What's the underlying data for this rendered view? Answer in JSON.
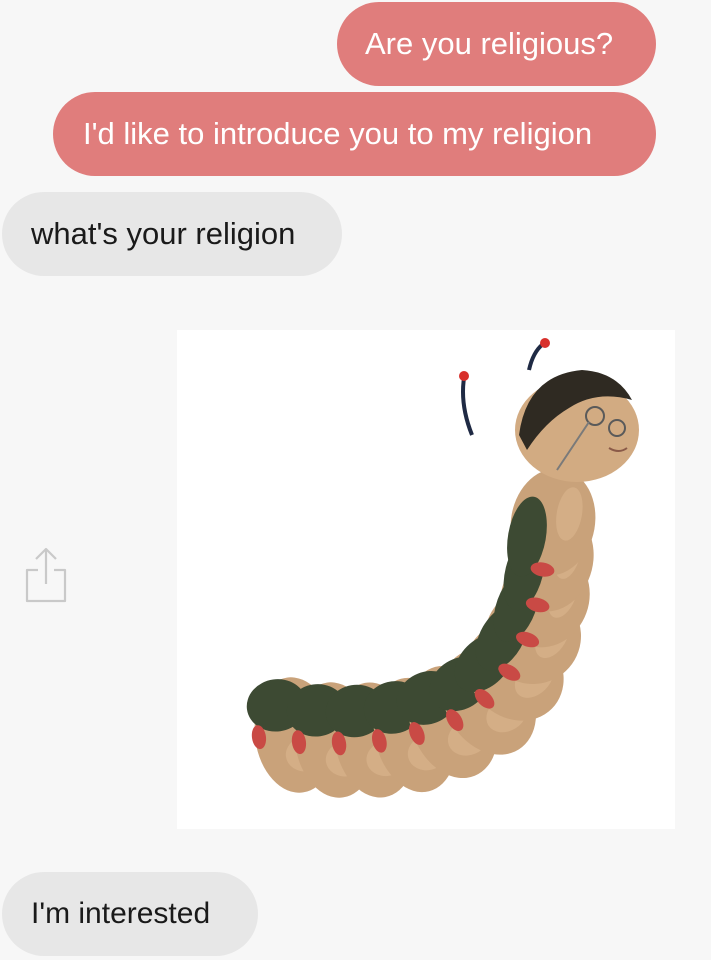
{
  "messages": [
    {
      "side": "sent",
      "text": "Are you religious?"
    },
    {
      "side": "sent",
      "text": "I'd like to introduce you to my religion"
    },
    {
      "side": "received",
      "text": "what's your religion"
    },
    {
      "side": "received",
      "image": "caterpillar-with-human-faces"
    },
    {
      "side": "received",
      "text": "I'm interested"
    }
  ],
  "share_icon": "share-icon",
  "colors": {
    "sent_bubble": "#e07d7c",
    "received_bubble": "#e7e7e7",
    "background": "#f7f7f7"
  }
}
